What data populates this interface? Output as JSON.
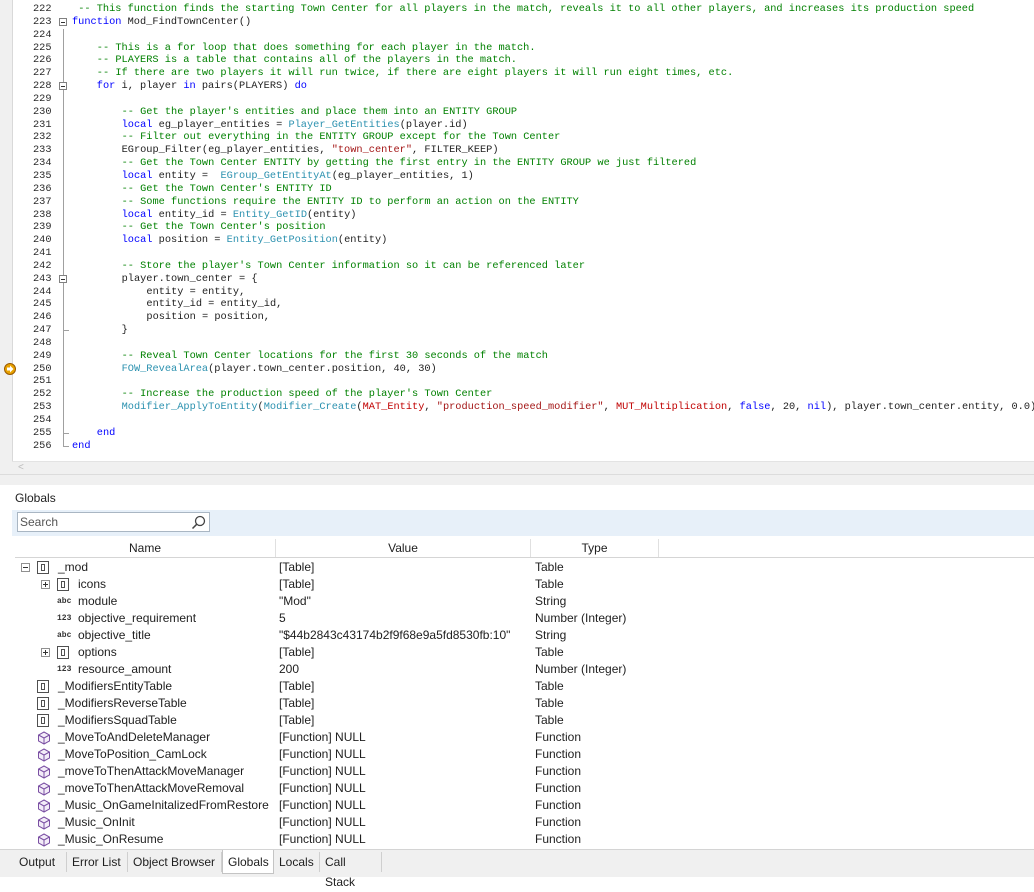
{
  "editor": {
    "lines": [
      {
        "n": "222",
        "segs": [
          [
            "c",
            "-- This function finds the starting Town Center for all players in the match, reveals it to all other players, and increases its production speed"
          ]
        ],
        "ind": 1,
        "fold": "none"
      },
      {
        "n": "223",
        "segs": [
          [
            "k",
            "function"
          ],
          [
            "p",
            " Mod_FindTownCenter()"
          ]
        ],
        "ind": 0,
        "fold": "open"
      },
      {
        "n": "224",
        "segs": [],
        "ind": 0,
        "fold": "line"
      },
      {
        "n": "225",
        "segs": [
          [
            "c",
            "-- This is a for loop that does something for each player in the match."
          ]
        ],
        "ind": 4,
        "fold": "line"
      },
      {
        "n": "226",
        "segs": [
          [
            "c",
            "-- PLAYERS is a table that contains all of the players in the match."
          ]
        ],
        "ind": 4,
        "fold": "line"
      },
      {
        "n": "227",
        "segs": [
          [
            "c",
            "-- If there are two players it will run twice, if there are eight players it will run eight times, etc."
          ]
        ],
        "ind": 4,
        "fold": "line"
      },
      {
        "n": "228",
        "segs": [
          [
            "k",
            "for"
          ],
          [
            "p",
            " i, player "
          ],
          [
            "k",
            "in"
          ],
          [
            "p",
            " pairs(PLAYERS) "
          ],
          [
            "k",
            "do"
          ]
        ],
        "ind": 4,
        "fold": "open"
      },
      {
        "n": "229",
        "segs": [],
        "ind": 0,
        "fold": "line"
      },
      {
        "n": "230",
        "segs": [
          [
            "c",
            "-- Get the player's entities and place them into an ENTITY GROUP"
          ]
        ],
        "ind": 8,
        "fold": "line"
      },
      {
        "n": "231",
        "segs": [
          [
            "k",
            "local"
          ],
          [
            "p",
            " eg_player_entities = "
          ],
          [
            "f",
            "Player_GetEntities"
          ],
          [
            "p",
            "(player.id)"
          ]
        ],
        "ind": 8,
        "fold": "line"
      },
      {
        "n": "232",
        "segs": [
          [
            "c",
            "-- Filter out everything in the ENTITY GROUP except for the Town Center"
          ]
        ],
        "ind": 8,
        "fold": "line"
      },
      {
        "n": "233",
        "segs": [
          [
            "p",
            "EGroup_Filter(eg_player_entities, "
          ],
          [
            "s",
            "\"town_center\""
          ],
          [
            "p",
            ", FILTER_KEEP)"
          ]
        ],
        "ind": 8,
        "fold": "line"
      },
      {
        "n": "234",
        "segs": [
          [
            "c",
            "-- Get the Town Center ENTITY by getting the first entry in the ENTITY GROUP we just filtered"
          ]
        ],
        "ind": 8,
        "fold": "line"
      },
      {
        "n": "235",
        "segs": [
          [
            "k",
            "local"
          ],
          [
            "p",
            " entity =  "
          ],
          [
            "f",
            "EGroup_GetEntityAt"
          ],
          [
            "p",
            "(eg_player_entities, 1)"
          ]
        ],
        "ind": 8,
        "fold": "line"
      },
      {
        "n": "236",
        "segs": [
          [
            "c",
            "-- Get the Town Center's ENTITY ID"
          ]
        ],
        "ind": 8,
        "fold": "line"
      },
      {
        "n": "237",
        "segs": [
          [
            "c",
            "-- Some functions require the ENTITY ID to perform an action on the ENTITY"
          ]
        ],
        "ind": 8,
        "fold": "line"
      },
      {
        "n": "238",
        "segs": [
          [
            "k",
            "local"
          ],
          [
            "p",
            " entity_id = "
          ],
          [
            "f",
            "Entity_GetID"
          ],
          [
            "p",
            "(entity)"
          ]
        ],
        "ind": 8,
        "fold": "line"
      },
      {
        "n": "239",
        "segs": [
          [
            "c",
            "-- Get the Town Center's position"
          ]
        ],
        "ind": 8,
        "fold": "line"
      },
      {
        "n": "240",
        "segs": [
          [
            "k",
            "local"
          ],
          [
            "p",
            " position = "
          ],
          [
            "f",
            "Entity_GetPosition"
          ],
          [
            "p",
            "(entity)"
          ]
        ],
        "ind": 8,
        "fold": "line"
      },
      {
        "n": "241",
        "segs": [],
        "ind": 0,
        "fold": "line"
      },
      {
        "n": "242",
        "segs": [
          [
            "c",
            "-- Store the player's Town Center information so it can be referenced later"
          ]
        ],
        "ind": 8,
        "fold": "line"
      },
      {
        "n": "243",
        "segs": [
          [
            "p",
            "player.town_center = {"
          ]
        ],
        "ind": 8,
        "fold": "open"
      },
      {
        "n": "244",
        "segs": [
          [
            "p",
            "entity = entity,"
          ]
        ],
        "ind": 12,
        "fold": "line"
      },
      {
        "n": "245",
        "segs": [
          [
            "p",
            "entity_id = entity_id,"
          ]
        ],
        "ind": 12,
        "fold": "line"
      },
      {
        "n": "246",
        "segs": [
          [
            "p",
            "position = position,"
          ]
        ],
        "ind": 12,
        "fold": "line"
      },
      {
        "n": "247",
        "segs": [
          [
            "p",
            "}"
          ]
        ],
        "ind": 8,
        "fold": "end"
      },
      {
        "n": "248",
        "segs": [],
        "ind": 0,
        "fold": "line"
      },
      {
        "n": "249",
        "segs": [
          [
            "c",
            "-- Reveal Town Center locations for the first 30 seconds of the match"
          ]
        ],
        "ind": 8,
        "fold": "line"
      },
      {
        "n": "250",
        "segs": [
          [
            "f",
            "FOW_RevealArea"
          ],
          [
            "p",
            "(player.town_center.position, 40, 30)"
          ]
        ],
        "ind": 8,
        "fold": "line",
        "bp": true
      },
      {
        "n": "251",
        "segs": [],
        "ind": 0,
        "fold": "line"
      },
      {
        "n": "252",
        "segs": [
          [
            "c",
            "-- Increase the production speed of the player's Town Center"
          ]
        ],
        "ind": 8,
        "fold": "line"
      },
      {
        "n": "253",
        "segs": [
          [
            "f",
            "Modifier_ApplyToEntity"
          ],
          [
            "p",
            "("
          ],
          [
            "f",
            "Modifier_Create"
          ],
          [
            "p",
            "("
          ],
          [
            "r",
            "MAT_Entity"
          ],
          [
            "p",
            ", "
          ],
          [
            "s",
            "\"production_speed_modifier\""
          ],
          [
            "p",
            ", "
          ],
          [
            "r",
            "MUT_Multiplication"
          ],
          [
            "p",
            ", "
          ],
          [
            "k",
            "false"
          ],
          [
            "p",
            ", 20, "
          ],
          [
            "k",
            "nil"
          ],
          [
            "p",
            "), player.town_center.entity, 0.0)"
          ]
        ],
        "ind": 8,
        "fold": "line"
      },
      {
        "n": "254",
        "segs": [],
        "ind": 0,
        "fold": "line"
      },
      {
        "n": "255",
        "segs": [
          [
            "k",
            "end"
          ]
        ],
        "ind": 4,
        "fold": "end"
      },
      {
        "n": "256",
        "segs": [
          [
            "k",
            "end"
          ]
        ],
        "ind": 0,
        "fold": "endlast"
      }
    ]
  },
  "globals": {
    "title": "Globals",
    "search_placeholder": "Search",
    "columns": {
      "name": "Name",
      "value": "Value",
      "type": "Type"
    },
    "rows": [
      {
        "depth": 0,
        "expander": "minus",
        "icon": "table-icon",
        "name": "_mod",
        "value": "[Table]",
        "type": "Table"
      },
      {
        "depth": 1,
        "expander": "plus",
        "icon": "table-icon",
        "name": "icons",
        "value": "[Table]",
        "type": "Table"
      },
      {
        "depth": 1,
        "expander": "none",
        "icon": "string-icon",
        "icon_text": "abc",
        "name": "module",
        "value": "\"Mod\"",
        "type": "String"
      },
      {
        "depth": 1,
        "expander": "none",
        "icon": "number-icon",
        "icon_text": "123",
        "name": "objective_requirement",
        "value": "5",
        "type": "Number (Integer)"
      },
      {
        "depth": 1,
        "expander": "none",
        "icon": "string-icon",
        "icon_text": "abc",
        "name": "objective_title",
        "value": "\"$44b2843c43174b2f9f68e9a5fd8530fb:10\"",
        "type": "String"
      },
      {
        "depth": 1,
        "expander": "plus",
        "icon": "table-icon",
        "name": "options",
        "value": "[Table]",
        "type": "Table"
      },
      {
        "depth": 1,
        "expander": "none",
        "icon": "number-icon",
        "icon_text": "123",
        "name": "resource_amount",
        "value": "200",
        "type": "Number (Integer)"
      },
      {
        "depth": 0,
        "expander": "none",
        "icon": "table-icon",
        "name": "_ModifiersEntityTable",
        "value": "[Table]",
        "type": "Table"
      },
      {
        "depth": 0,
        "expander": "none",
        "icon": "table-icon",
        "name": "_ModifiersReverseTable",
        "value": "[Table]",
        "type": "Table"
      },
      {
        "depth": 0,
        "expander": "none",
        "icon": "table-icon",
        "name": "_ModifiersSquadTable",
        "value": "[Table]",
        "type": "Table"
      },
      {
        "depth": 0,
        "expander": "none",
        "icon": "function-icon",
        "name": "_MoveToAndDeleteManager",
        "value": "[Function] NULL",
        "type": "Function"
      },
      {
        "depth": 0,
        "expander": "none",
        "icon": "function-icon",
        "name": "_MoveToPosition_CamLock",
        "value": "[Function] NULL",
        "type": "Function"
      },
      {
        "depth": 0,
        "expander": "none",
        "icon": "function-icon",
        "name": "_moveToThenAttackMoveManager",
        "value": "[Function] NULL",
        "type": "Function"
      },
      {
        "depth": 0,
        "expander": "none",
        "icon": "function-icon",
        "name": "_moveToThenAttackMoveRemoval",
        "value": "[Function] NULL",
        "type": "Function"
      },
      {
        "depth": 0,
        "expander": "none",
        "icon": "function-icon",
        "name": "_Music_OnGameInitalizedFromRestore",
        "value": "[Function] NULL",
        "type": "Function"
      },
      {
        "depth": 0,
        "expander": "none",
        "icon": "function-icon",
        "name": "_Music_OnInit",
        "value": "[Function] NULL",
        "type": "Function"
      },
      {
        "depth": 0,
        "expander": "none",
        "icon": "function-icon",
        "name": "_Music_OnResume",
        "value": "[Function] NULL",
        "type": "Function"
      }
    ]
  },
  "tabs": [
    {
      "label": "Output",
      "active": false
    },
    {
      "label": "Error List",
      "active": false
    },
    {
      "label": "Object Browser",
      "active": false
    },
    {
      "label": "Globals",
      "active": true
    },
    {
      "label": "Locals",
      "active": false
    },
    {
      "label": "Call Stack",
      "active": false
    }
  ]
}
